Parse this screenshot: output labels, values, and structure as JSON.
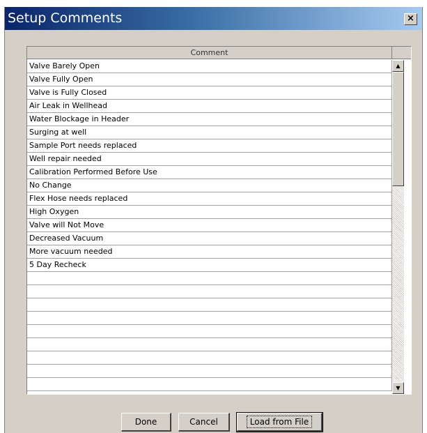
{
  "window": {
    "title": "Setup Comments",
    "close_glyph": "×"
  },
  "grid": {
    "column_header": "Comment",
    "rows": [
      "Valve Barely Open",
      "Valve Fully Open",
      "Valve is Fully Closed",
      "Air Leak in Wellhead",
      "Water Blockage in Header",
      "Surging at well",
      "Sample Port needs replaced",
      "Well repair needed",
      "Calibration Performed Before Use",
      "No Change",
      "Flex Hose needs replaced",
      "High Oxygen",
      "Valve will Not Move",
      "Decreased Vacuum",
      "More vacuum needed",
      "5 Day Recheck",
      "",
      "",
      "",
      "",
      "",
      "",
      "",
      "",
      ""
    ]
  },
  "scrollbar": {
    "up_icon": "arrow-up-icon",
    "down_icon": "arrow-down-icon"
  },
  "buttons": {
    "done_label": "Done",
    "cancel_label": "Cancel",
    "load_label": "Load from File"
  },
  "colors": {
    "title_bar_start": "#0a246a",
    "title_bar_end": "#a6caf0",
    "dialog_face": "#d4d0c8"
  }
}
